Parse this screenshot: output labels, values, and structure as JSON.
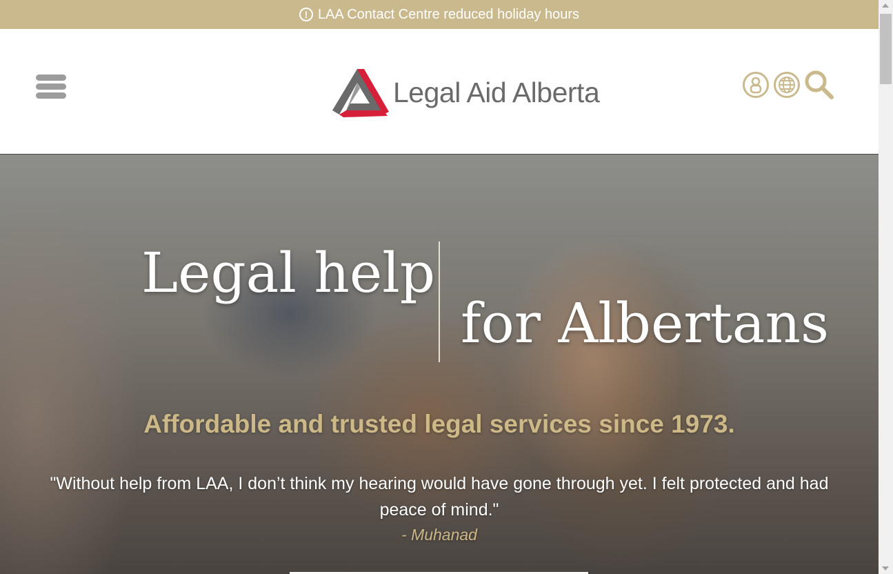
{
  "alert": {
    "icon": "exclamation-circle-icon",
    "text": "LAA Contact Centre reduced holiday hours"
  },
  "header": {
    "menu_icon": "hamburger-menu-icon",
    "logo": {
      "icon": "legal-aid-alberta-triangle-logo",
      "text": "Legal Aid Alberta"
    },
    "icons": [
      "account-icon",
      "globe-icon",
      "search-icon"
    ]
  },
  "hero": {
    "headline_left": "Legal help",
    "headline_right": "for Albertans",
    "tagline": "Affordable and trusted legal services since 1973.",
    "quote": "\"Without help from LAA, I don’t think my hearing would have gone through yet. I felt protected and had peace of mind.\"",
    "quote_author": "- Muhanad"
  },
  "colors": {
    "accent_gold": "#c9b98c",
    "logo_red": "#d6203a",
    "logo_gray": "#6a6a6a"
  }
}
